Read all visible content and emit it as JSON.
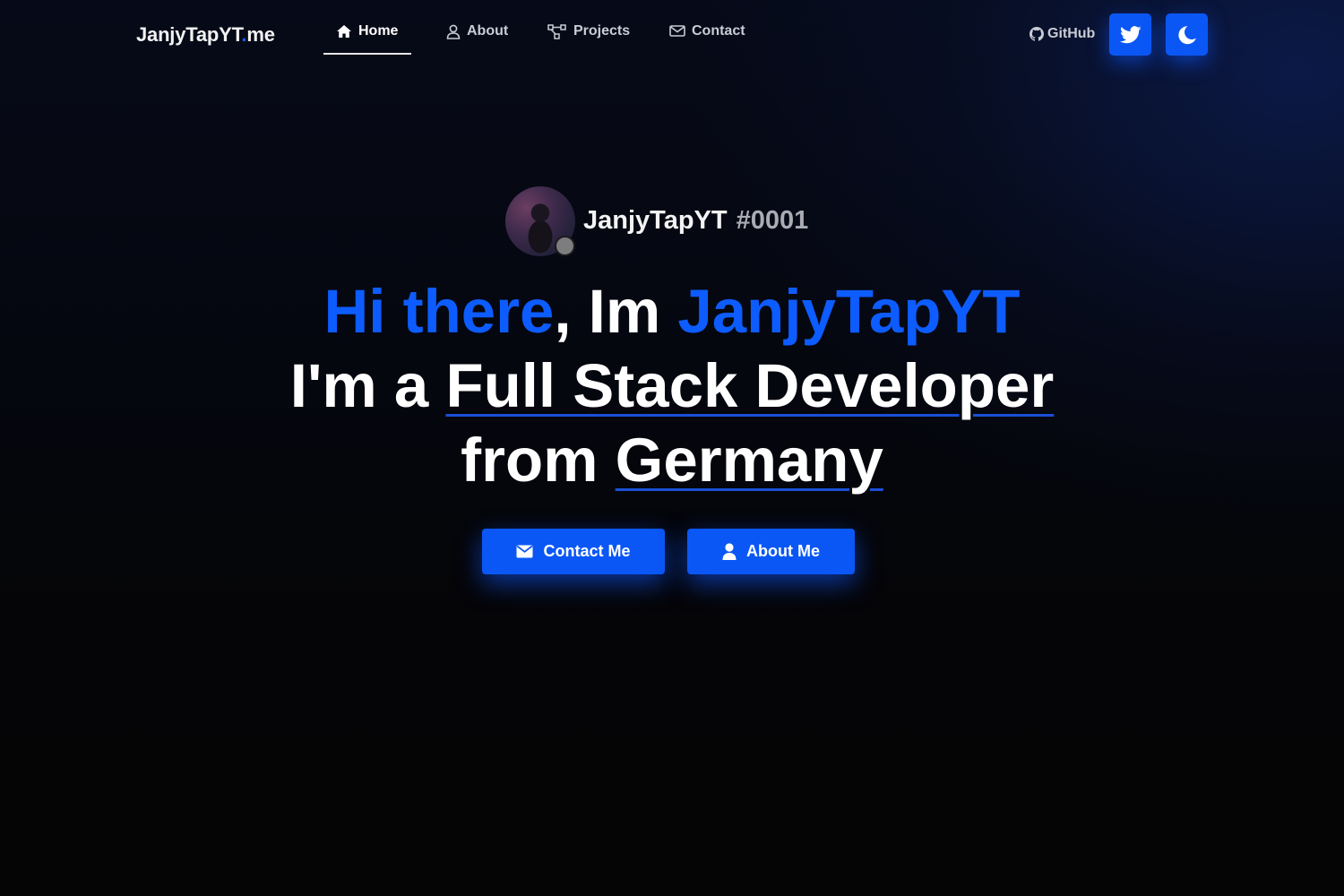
{
  "nav": {
    "brand_main": "JanjyTapYT",
    "brand_dot": ".",
    "brand_suffix": "me",
    "links": [
      {
        "label": "Home",
        "icon": "home-icon",
        "active": true
      },
      {
        "label": "About",
        "icon": "user-icon",
        "active": false
      },
      {
        "label": "Projects",
        "icon": "nodes-icon",
        "active": false
      },
      {
        "label": "Contact",
        "icon": "envelope-icon",
        "active": false
      }
    ],
    "github_label": "GitHub",
    "twitter_icon": "twitter-icon",
    "theme_icon": "moon-icon"
  },
  "profile": {
    "username": "JanjyTapYT",
    "discriminator": "#0001",
    "status": "offline"
  },
  "hero": {
    "line1_greeting": "Hi there",
    "line1_comma": ", Im ",
    "line1_name": "JanjyTapYT",
    "line2_prefix": "I'm a ",
    "line2_role": "Full Stack Developer",
    "line3_prefix": "from ",
    "line3_country": "Germany"
  },
  "buttons": {
    "contact_label": "Contact Me",
    "about_label": "About Me"
  },
  "colors": {
    "accent": "#0d5cff",
    "button": "#0b57f5",
    "background": "#050507"
  }
}
